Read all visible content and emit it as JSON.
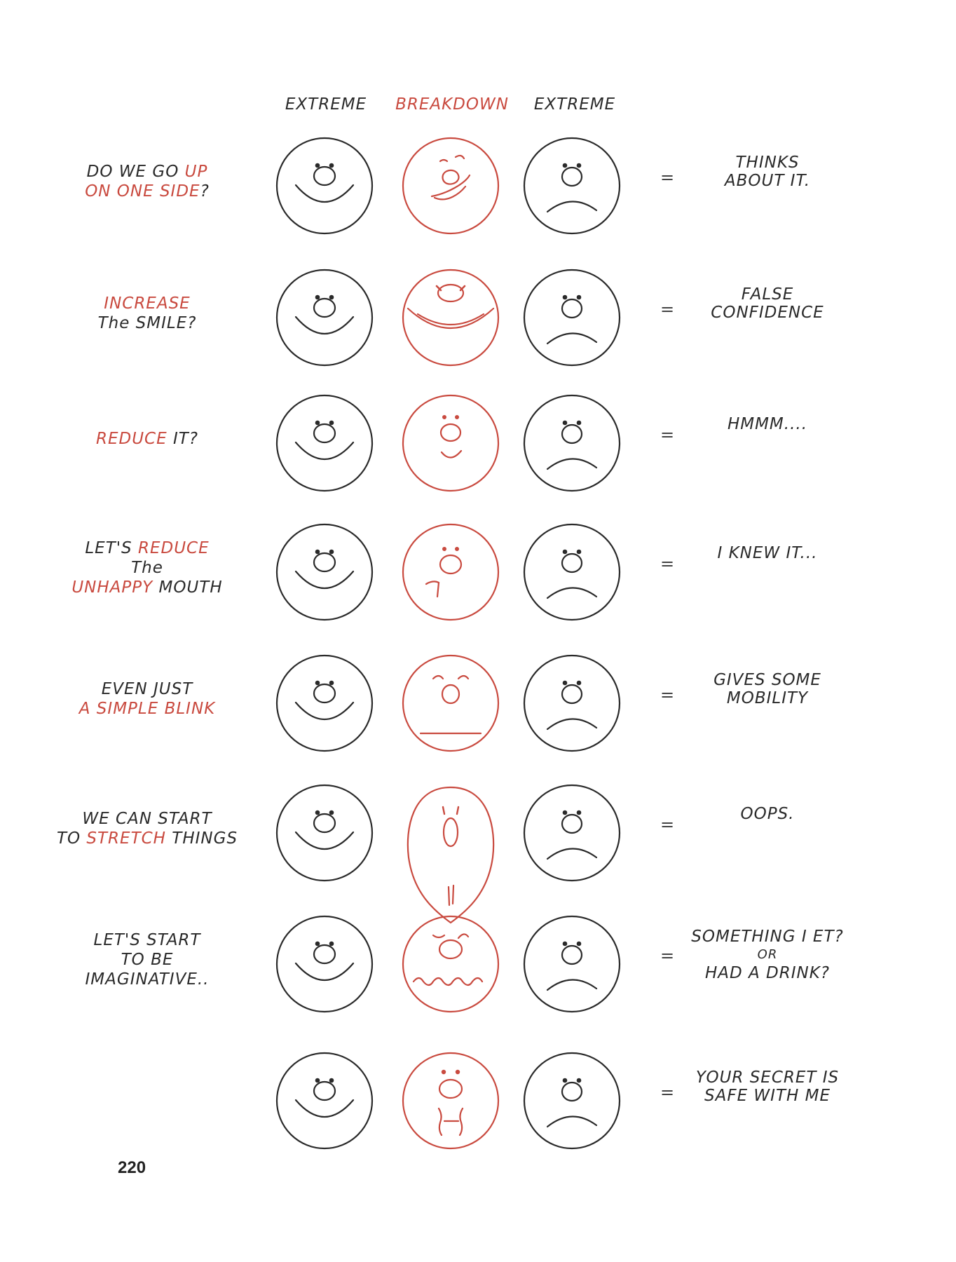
{
  "headers": {
    "left": "EXTREME",
    "middle": "BREAKDOWN",
    "right": "EXTREME"
  },
  "colors": {
    "pencil": "#2a2a2a",
    "red": "#c94a3f"
  },
  "rows": [
    {
      "left": [
        [
          {
            "t": "DO WE GO ",
            "c": "dark"
          },
          {
            "t": "UP",
            "c": "red"
          }
        ],
        [
          {
            "t": "ON ONE SIDE",
            "c": "red"
          },
          {
            "t": "?",
            "c": "dark"
          }
        ]
      ],
      "right": [
        "THINKS",
        "ABOUT IT."
      ],
      "breakdown": "tilt"
    },
    {
      "left": [
        [
          {
            "t": "INCREASE",
            "c": "red"
          }
        ],
        [
          {
            "t": "The SMILE?",
            "c": "dark"
          }
        ]
      ],
      "right": [
        "FALSE",
        "CONFIDENCE"
      ],
      "breakdown": "big-smile"
    },
    {
      "left": [
        [
          {
            "t": "REDUCE",
            "c": "red"
          },
          {
            "t": " IT?",
            "c": "dark"
          }
        ]
      ],
      "right": [
        "HMMM...."
      ],
      "breakdown": "small-smile"
    },
    {
      "left": [
        [
          {
            "t": "LET'S ",
            "c": "dark"
          },
          {
            "t": "REDUCE",
            "c": "red"
          }
        ],
        [
          {
            "t": "The",
            "c": "dark"
          }
        ],
        [
          {
            "t": "UNHAPPY",
            "c": "red"
          },
          {
            "t": " MOUTH",
            "c": "dark"
          }
        ]
      ],
      "right": [
        "I KNEW IT..."
      ],
      "breakdown": "hook"
    },
    {
      "left": [
        [
          {
            "t": "EVEN JUST",
            "c": "dark"
          }
        ],
        [
          {
            "t": "A SIMPLE BLINK",
            "c": "red"
          }
        ]
      ],
      "right": [
        "GIVES SOME",
        "MOBILITY"
      ],
      "breakdown": "blink"
    },
    {
      "left": [
        [
          {
            "t": "WE CAN START",
            "c": "dark"
          }
        ],
        [
          {
            "t": "TO ",
            "c": "dark"
          },
          {
            "t": "STRETCH",
            "c": "red"
          },
          {
            "t": " THINGS",
            "c": "dark"
          }
        ]
      ],
      "right": [
        "OOPS."
      ],
      "breakdown": "stretch"
    },
    {
      "left": [
        [
          {
            "t": "LET'S START",
            "c": "dark"
          }
        ],
        [
          {
            "t": "TO BE",
            "c": "dark"
          }
        ],
        [
          {
            "t": "IMAGINATIVE..",
            "c": "dark"
          }
        ]
      ],
      "right": [
        "SOMETHING I ET?",
        "OR",
        "HAD A DRINK?"
      ],
      "breakdown": "wavy"
    },
    {
      "left": [],
      "right": [
        "YOUR SECRET IS",
        "SAFE WITH ME"
      ],
      "breakdown": "zipped"
    }
  ],
  "page_number": "220"
}
